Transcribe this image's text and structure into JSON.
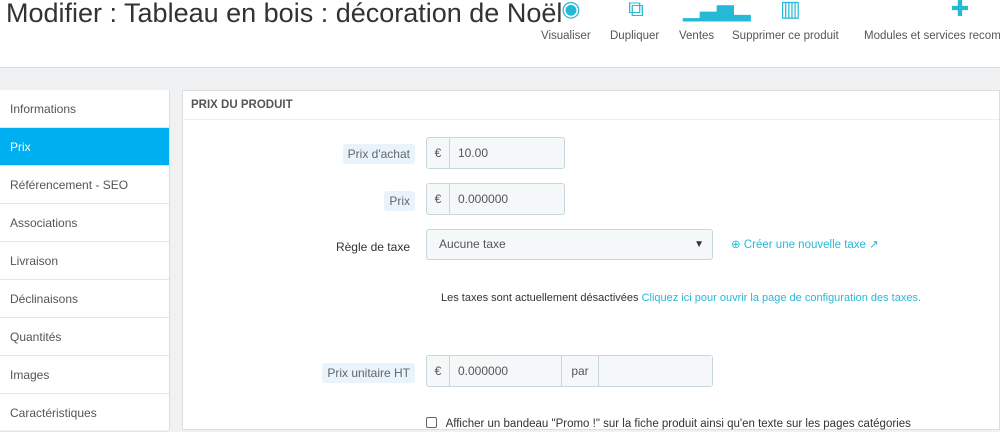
{
  "header": {
    "title": "Modifier : Tableau en bois : décoration de Noël",
    "toolbar": [
      {
        "label": "Visualiser",
        "icon": "eye-icon"
      },
      {
        "label": "Dupliquer",
        "icon": "copy-icon"
      },
      {
        "label": "Ventes",
        "icon": "bar-chart-icon"
      },
      {
        "label": "Supprimer ce produit",
        "icon": "trash-icon"
      },
      {
        "label": "Modules et services recommandés",
        "icon": "puzzle-icon"
      }
    ]
  },
  "sidebar": {
    "items": [
      "Informations",
      "Prix",
      "Référencement - SEO",
      "Associations",
      "Livraison",
      "Déclinaisons",
      "Quantités",
      "Images",
      "Caractéristiques"
    ]
  },
  "panel": {
    "title": "PRIX DU PRODUIT",
    "purchase_price": {
      "label": "Prix d'achat",
      "currency": "€",
      "value": "10.00"
    },
    "price": {
      "label": "Prix",
      "currency": "€",
      "value": "0.000000"
    },
    "tax_rule": {
      "label": "Règle de taxe",
      "value": "Aucune taxe",
      "create_link": "Créer une nouvelle taxe"
    },
    "tax_notice": {
      "text": "Les taxes sont actuellement désactivées",
      "link": "Cliquez ici pour ouvrir la page de configuration des taxes."
    },
    "unit_price": {
      "label": "Prix unitaire HT",
      "currency": "€",
      "value": "0.000000",
      "per": "par",
      "unit": ""
    },
    "promo_checkbox": "Afficher un bandeau \"Promo !\" sur la fiche produit ainsi qu'en texte sur les pages catégories"
  },
  "colors": {
    "accent": "#25b9d7",
    "active": "#00aff0"
  }
}
